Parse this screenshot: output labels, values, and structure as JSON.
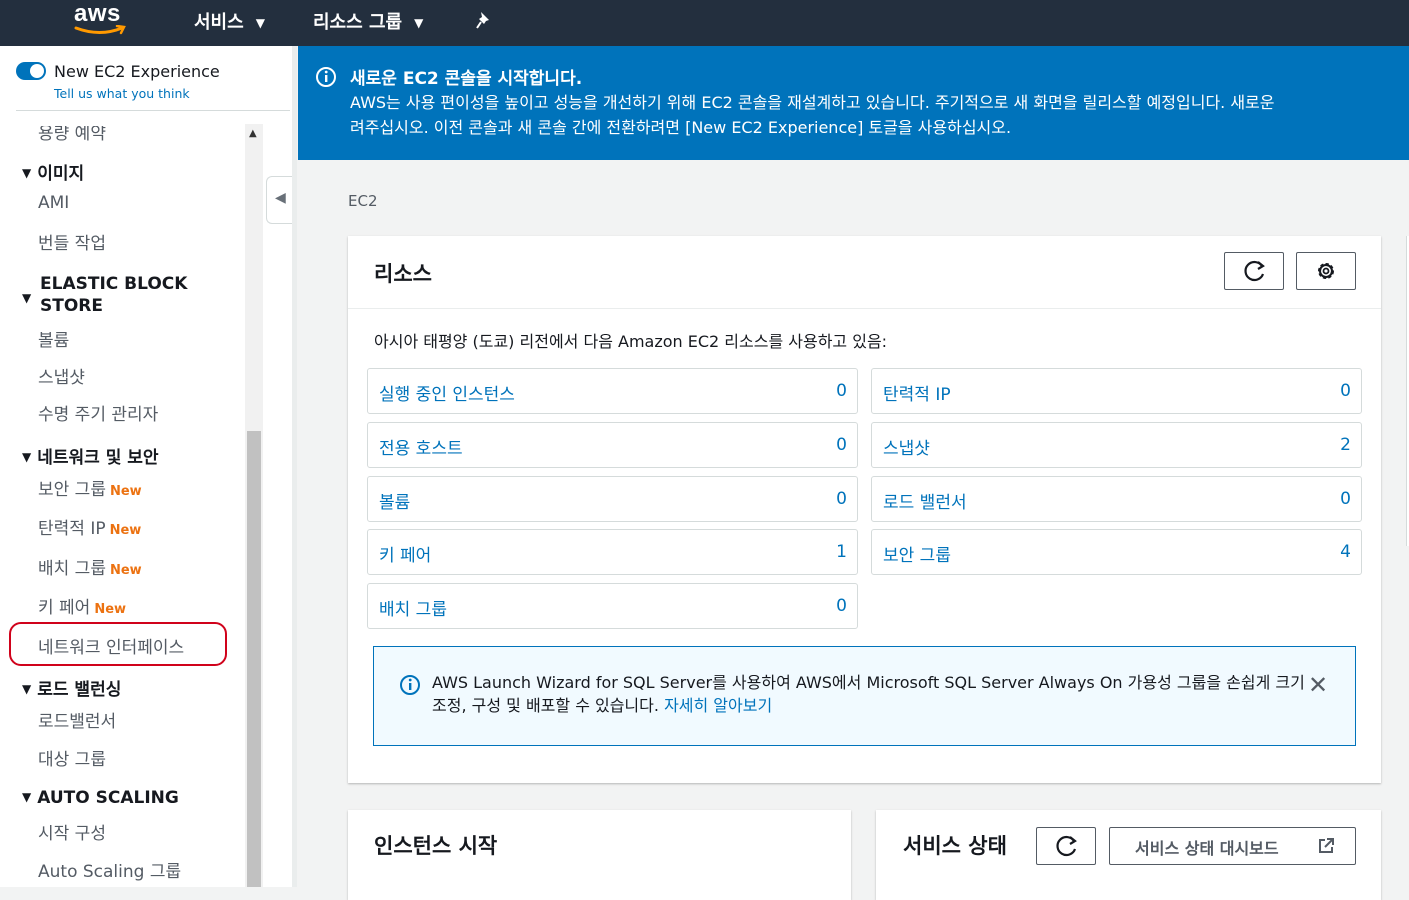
{
  "topnav": {
    "logo_text": "aws",
    "services_label": "서비스",
    "resource_groups_label": "리소스 그룹",
    "pin_icon": "pin-icon"
  },
  "sidebar": {
    "toggle_label": "New EC2 Experience",
    "toggle_on": true,
    "feedback_link": "Tell us what you think",
    "partial_item": "용량 예약",
    "sections": {
      "images": {
        "title": "이미지",
        "items": [
          "AMI",
          "번들 작업"
        ]
      },
      "ebs": {
        "title_line1": "ELASTIC BLOCK",
        "title_line2": "STORE",
        "items": [
          "볼륨",
          "스냅샷",
          "수명 주기 관리자"
        ]
      },
      "network": {
        "title": "네트워크 및 보안",
        "items": [
          {
            "label": "보안 그룹",
            "badge": "New"
          },
          {
            "label": "탄력적 IP",
            "badge": "New"
          },
          {
            "label": "배치 그룹",
            "badge": "New"
          },
          {
            "label": "키 페어",
            "badge": "New"
          },
          {
            "label": "네트워크 인터페이스"
          }
        ]
      },
      "lb": {
        "title": "로드 밸런싱",
        "items": [
          "로드밸런서",
          "대상 그룹"
        ]
      },
      "asg": {
        "title": "AUTO SCALING",
        "items": [
          "시작 구성",
          "Auto Scaling 그룹"
        ]
      }
    }
  },
  "banner": {
    "title": "새로운 EC2 콘솔을 시작합니다.",
    "line1": "AWS는 사용 편이성을 높이고 성능을 개선하기 위해 EC2 콘솔을 재설계하고 있습니다. 주기적으로 새 화면을 릴리스할 예정입니다. 새로운",
    "line2": "려주십시오. 이전 콘솔과 새 콘솔 간에 전환하려면 [New EC2 Experience] 토글을 사용하십시오."
  },
  "breadcrumb": "EC2",
  "resources": {
    "title": "리소스",
    "description": "아시아 태평양 (도쿄) 리전에서 다음 Amazon EC2 리소스를 사용하고 있음:",
    "tiles": [
      {
        "label": "실행 중인 인스턴스",
        "count": "0"
      },
      {
        "label": "탄력적 IP",
        "count": "0"
      },
      {
        "label": "전용 호스트",
        "count": "0"
      },
      {
        "label": "스냅샷",
        "count": "2"
      },
      {
        "label": "볼륨",
        "count": "0"
      },
      {
        "label": "로드 밸런서",
        "count": "0"
      },
      {
        "label": "키 페어",
        "count": "1"
      },
      {
        "label": "보안 그룹",
        "count": "4"
      },
      {
        "label": "배치 그룹",
        "count": "0"
      }
    ],
    "alert": {
      "text": "AWS Launch Wizard for SQL Server를 사용하여 AWS에서 Microsoft SQL Server Always On 가용성 그룹을 손쉽게 크기 조정, 구성 및 배포할 수 있습니다.",
      "link": "자세히 알아보기"
    }
  },
  "launch": {
    "title": "인스턴스 시작"
  },
  "service_health": {
    "title": "서비스 상태",
    "dashboard_button": "서비스 상태 대시보드"
  },
  "colors": {
    "nav_bg": "#232f3e",
    "banner_bg": "#0073bb",
    "link": "#0073bb",
    "new_badge": "#ec7211",
    "highlight": "#d0021b"
  }
}
